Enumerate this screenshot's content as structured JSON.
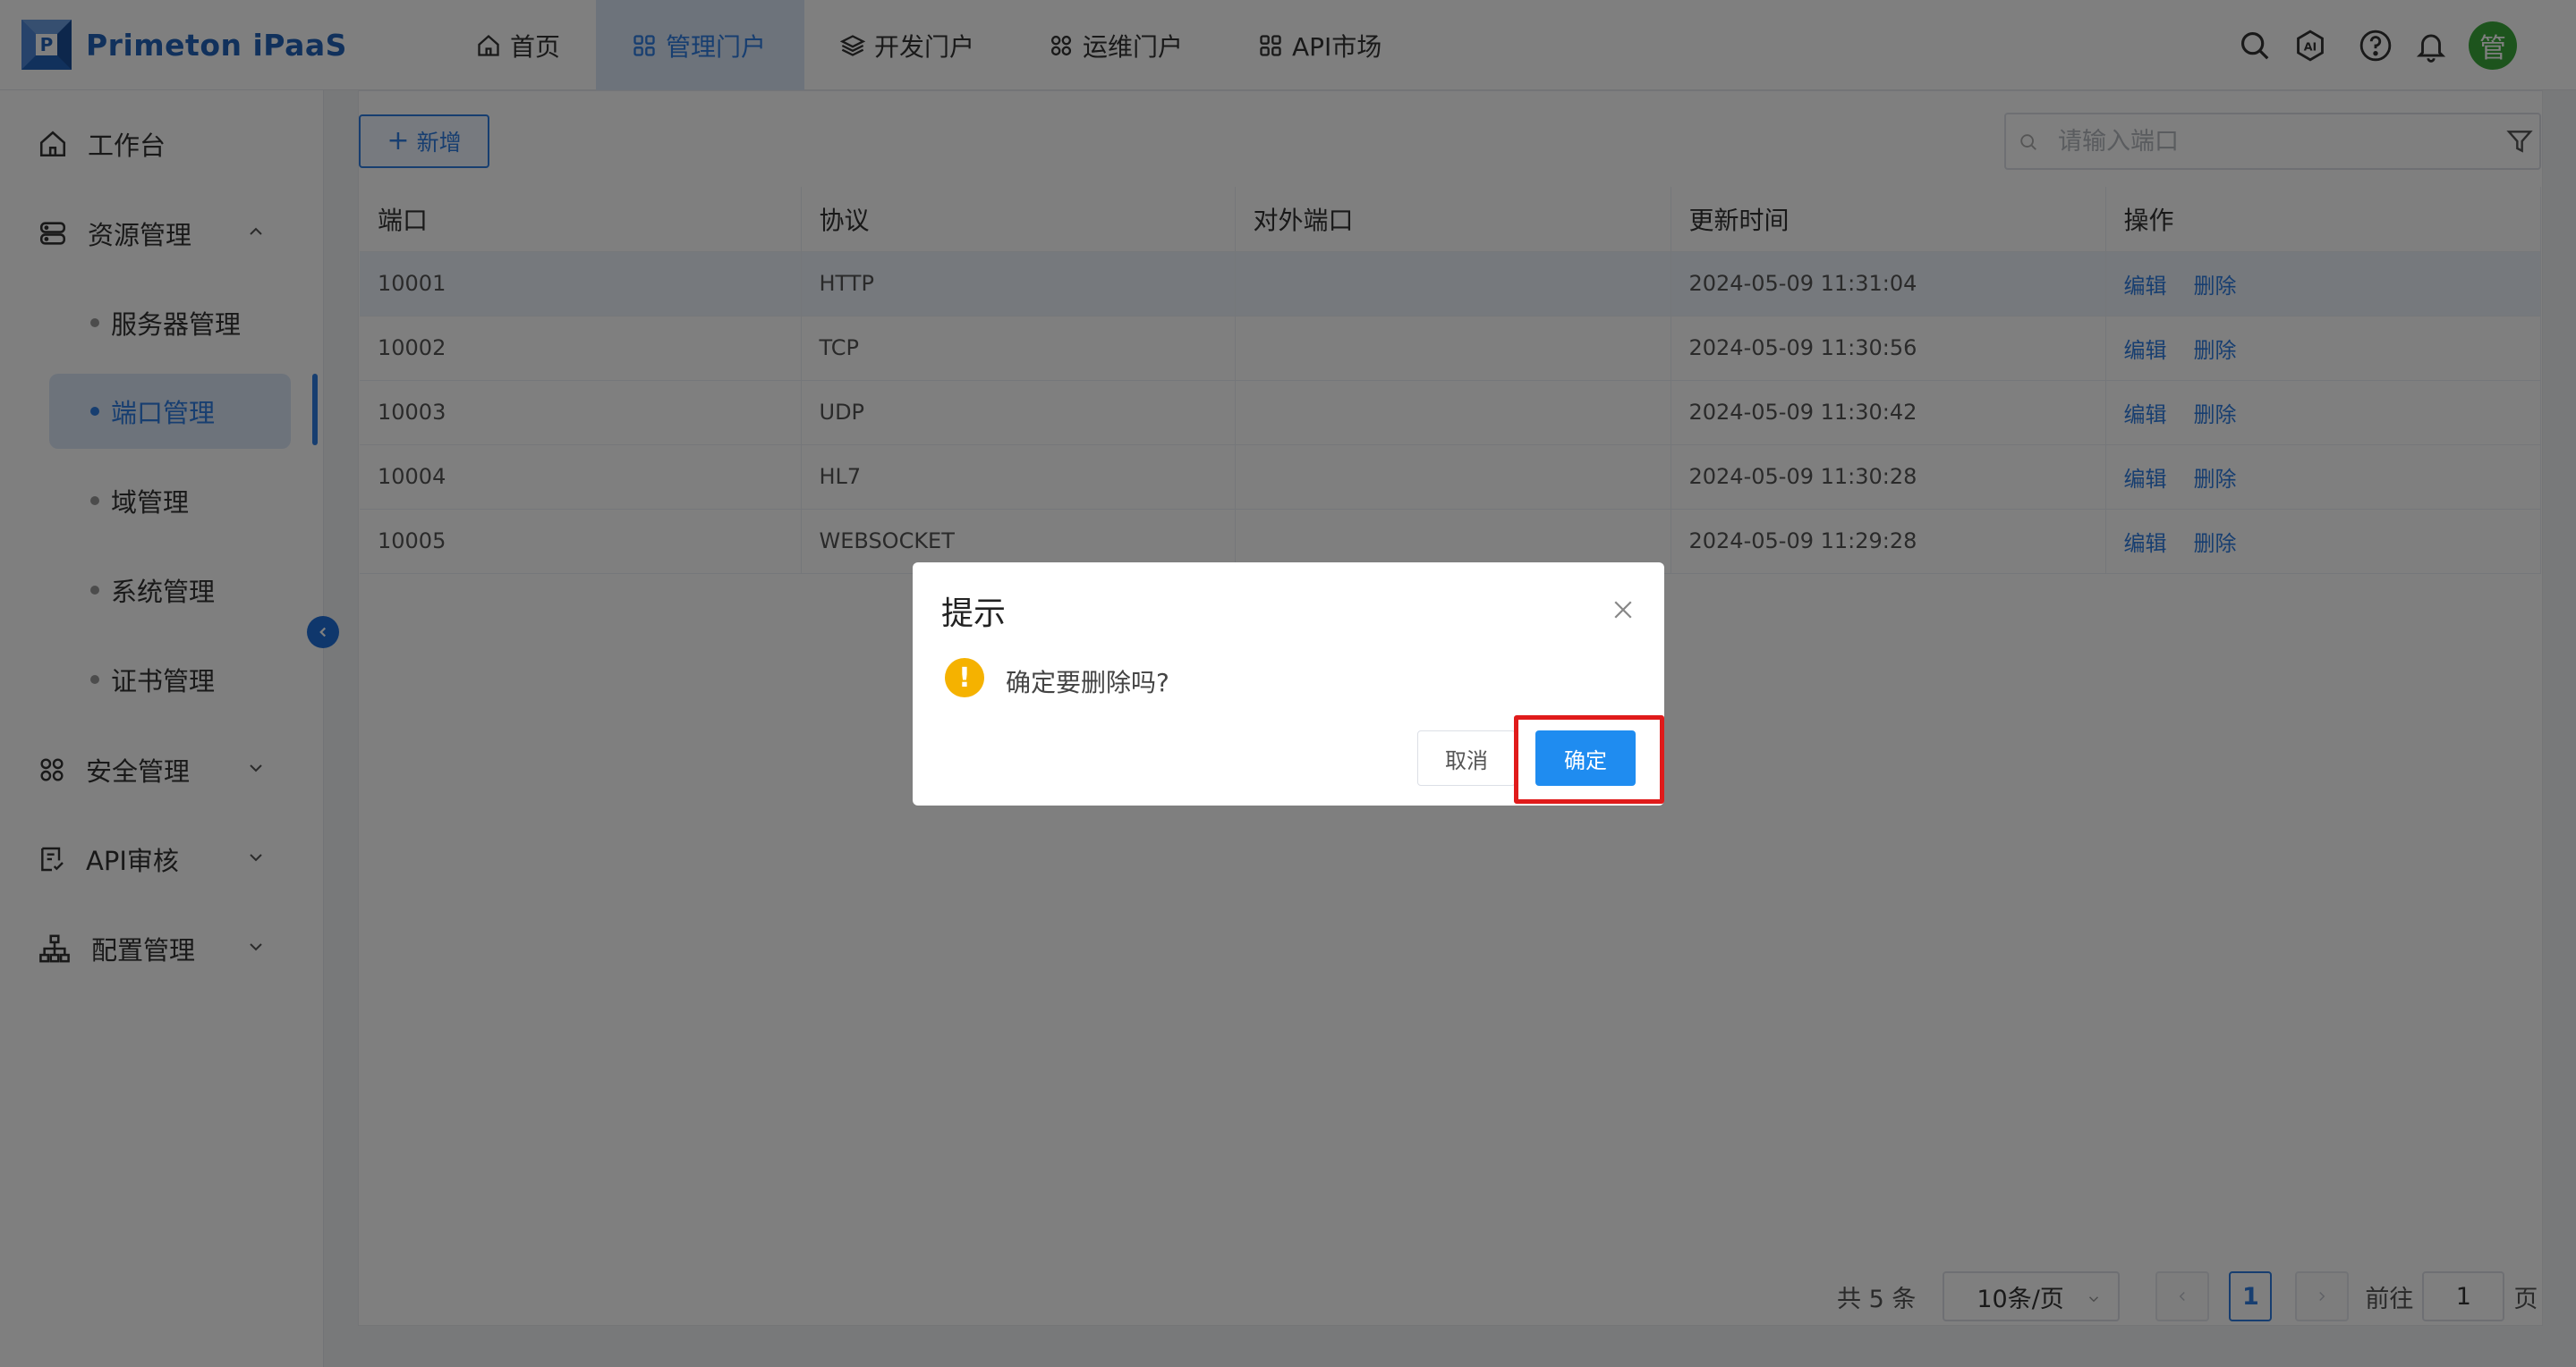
{
  "app": {
    "name": "Primeton iPaaS",
    "logo_letter": "P"
  },
  "nav": {
    "tabs": [
      {
        "label": "首页",
        "icon": "home-icon"
      },
      {
        "label": "管理门户",
        "icon": "grid-icon"
      },
      {
        "label": "开发门户",
        "icon": "layers-icon"
      },
      {
        "label": "运维门户",
        "icon": "apps-icon"
      },
      {
        "label": "API市场",
        "icon": "grid-icon"
      }
    ]
  },
  "header": {
    "icons": [
      "search-icon",
      "ai-icon",
      "help-icon",
      "bell-icon"
    ],
    "avatar_text": "管"
  },
  "sidebar": {
    "items": [
      {
        "label": "工作台",
        "icon": "home-icon"
      },
      {
        "label": "资源管理",
        "icon": "server-icon"
      },
      {
        "label": "安全管理",
        "icon": "apps-icon"
      },
      {
        "label": "API审核",
        "icon": "audit-icon"
      },
      {
        "label": "配置管理",
        "icon": "hierarchy-icon"
      }
    ],
    "sub_items": [
      {
        "label": "服务器管理"
      },
      {
        "label": "端口管理"
      },
      {
        "label": "域管理"
      },
      {
        "label": "系统管理"
      },
      {
        "label": "证书管理"
      }
    ]
  },
  "toolbar": {
    "add_label": "新增",
    "search_placeholder": "请输入端口"
  },
  "table": {
    "columns": [
      "端口",
      "协议",
      "对外端口",
      "更新时间",
      "操作"
    ],
    "rows": [
      {
        "port": "10001",
        "protocol": "HTTP",
        "external": "",
        "updated": "2024-05-09 11:31:04"
      },
      {
        "port": "10002",
        "protocol": "TCP",
        "external": "",
        "updated": "2024-05-09 11:30:56"
      },
      {
        "port": "10003",
        "protocol": "UDP",
        "external": "",
        "updated": "2024-05-09 11:30:42"
      },
      {
        "port": "10004",
        "protocol": "HL7",
        "external": "",
        "updated": "2024-05-09 11:30:28"
      },
      {
        "port": "10005",
        "protocol": "WEBSOCKET",
        "external": "",
        "updated": "2024-05-09 11:29:28"
      }
    ],
    "actions": {
      "edit": "编辑",
      "delete": "删除"
    }
  },
  "pagination": {
    "total": "共 5 条",
    "page_size": "10条/页",
    "current_page": "1",
    "goto_label": "前往",
    "goto_value": "1",
    "page_suffix": "页"
  },
  "dialog": {
    "title": "提示",
    "message": "确定要删除吗?",
    "warn_symbol": "!",
    "cancel_label": "取消",
    "confirm_label": "确定"
  },
  "colors": {
    "accent": "#2f7de1",
    "confirm": "#1f8cf0",
    "warning": "#f5b200",
    "highlight": "#e01b1b",
    "avatar": "#3aa83a"
  }
}
